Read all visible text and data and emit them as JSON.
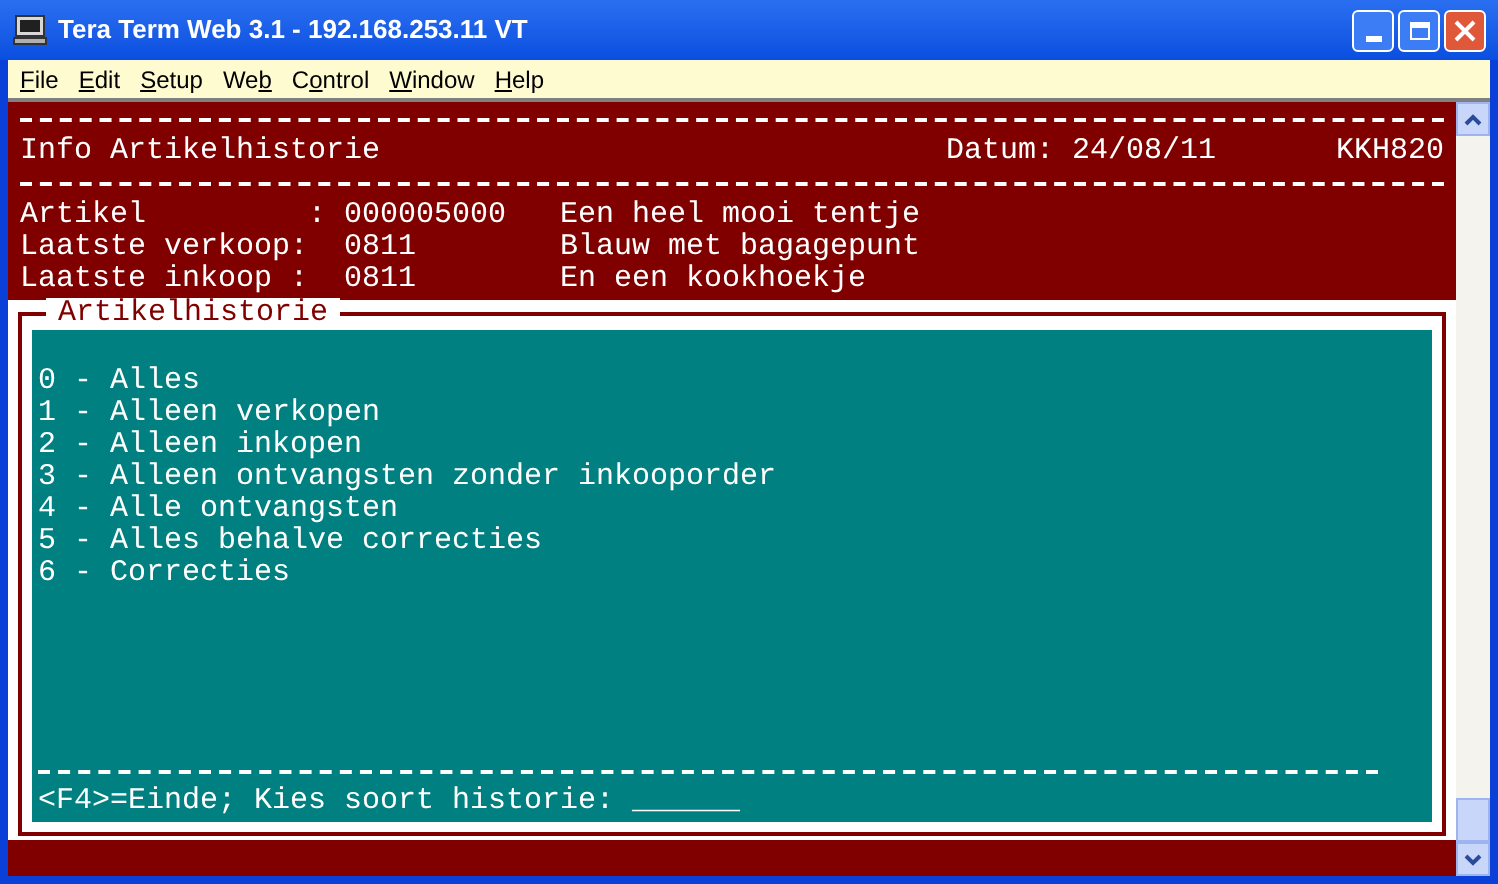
{
  "window": {
    "title": "Tera Term Web 3.1 - 192.168.253.11 VT"
  },
  "menu": [
    {
      "hotkey": "F",
      "rest": "ile"
    },
    {
      "hotkey": "E",
      "rest": "dit"
    },
    {
      "hotkey": "S",
      "rest": "etup"
    },
    {
      "before": "We",
      "hotkey": "b"
    },
    {
      "before": "C",
      "hotkey": "o",
      "rest": "ntrol"
    },
    {
      "hotkey": "W",
      "rest": "indow"
    },
    {
      "hotkey": "H",
      "rest": "elp"
    }
  ],
  "header": {
    "title": "Info Artikelhistorie",
    "date": "Datum: 24/08/11",
    "code": "KKH820"
  },
  "info_rows": [
    {
      "label": "Artikel         :",
      "value": "000005000",
      "description": "Een heel mooi tentje"
    },
    {
      "label": "Laatste verkoop:",
      "value": "0811",
      "description": "Blauw met bagagepunt"
    },
    {
      "label": "Laatste inkoop :",
      "value": "0811",
      "description": "En een kookhoekje"
    }
  ],
  "panel": {
    "title": "Artikelhistorie",
    "options": [
      "0 - Alles",
      "1 - Alleen verkopen",
      "2 - Alleen inkopen",
      "3 - Alleen ontvangsten zonder inkooporder",
      "4 - Alle ontvangsten",
      "5 - Alles behalve correcties",
      "6 - Correcties"
    ],
    "prompt": "<F4>=Einde; Kies soort historie:",
    "input_mask": "______"
  }
}
